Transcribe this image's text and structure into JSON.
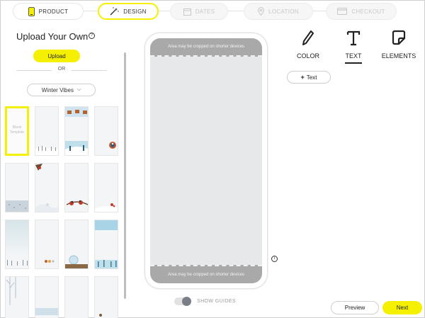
{
  "steps": [
    {
      "label": "PRODUCT",
      "icon": "phone-icon",
      "state": "done"
    },
    {
      "label": "DESIGN",
      "icon": "magic-wand-icon",
      "state": "active"
    },
    {
      "label": "DATES",
      "icon": "calendar-icon",
      "state": "disabled"
    },
    {
      "label": "LOCATION",
      "icon": "location-pin-icon",
      "state": "disabled"
    },
    {
      "label": "CHECKOUT",
      "icon": "credit-card-icon",
      "state": "disabled"
    }
  ],
  "left": {
    "title": "Upload Your Own",
    "help_icon": "?",
    "upload_label": "Upload",
    "or_label": "OR",
    "theme": "Winter Vibes",
    "blank_template_label": "Blank Template"
  },
  "phone": {
    "crop_notice_top": "Area may be cropped on shorter devices",
    "crop_notice_bottom": "Area may be cropped on shorter devices",
    "info_icon": "i"
  },
  "guides": {
    "label": "SHOW GUIDES",
    "enabled": true
  },
  "tools": [
    {
      "label": "COLOR",
      "icon": "pen-icon"
    },
    {
      "label": "TEXT",
      "icon": "text-t-icon",
      "active": true
    },
    {
      "label": "ELEMENTS",
      "icon": "sticker-icon"
    }
  ],
  "add_text_label": "Text",
  "footer": {
    "preview_label": "Preview",
    "next_label": "Next"
  },
  "colors": {
    "accent": "#f4f000",
    "crop_band": "#a9a9a9"
  }
}
